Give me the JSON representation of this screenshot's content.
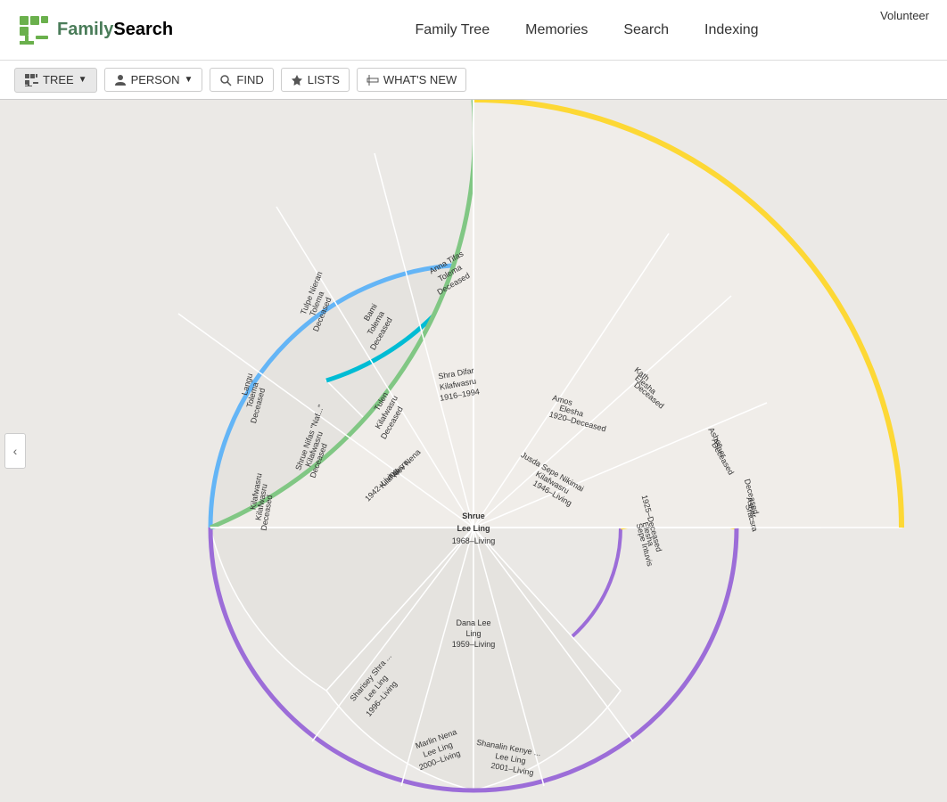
{
  "app": {
    "title": "FamilySearch",
    "volunteer_label": "Volunteer"
  },
  "nav": {
    "links": [
      {
        "label": "Family Tree",
        "id": "family-tree"
      },
      {
        "label": "Memories",
        "id": "memories"
      },
      {
        "label": "Search",
        "id": "search"
      },
      {
        "label": "Indexing",
        "id": "indexing"
      }
    ]
  },
  "subnav": {
    "buttons": [
      {
        "label": "TREE",
        "icon": "tree-icon",
        "active": true,
        "has_dropdown": true
      },
      {
        "label": "PERSON",
        "icon": "person-icon",
        "active": false,
        "has_dropdown": true
      },
      {
        "label": "FIND",
        "icon": "find-icon",
        "active": false,
        "has_dropdown": false
      },
      {
        "label": "LISTS",
        "icon": "lists-icon",
        "active": false,
        "has_dropdown": false
      },
      {
        "label": "WHAT'S NEW",
        "icon": "new-icon",
        "active": false,
        "has_dropdown": false
      }
    ]
  },
  "center_person": {
    "name": "Shrue\nLee Ling",
    "years": "1968–Living"
  },
  "people": [
    {
      "name": "Rev Nena\nKilafwasru",
      "years": "1942–Living",
      "ring": 1,
      "color": "teal"
    },
    {
      "name": "Dana Lee\nLing",
      "years": "1959–Living",
      "ring": 1,
      "color": "purple"
    },
    {
      "name": "Jusda Sepe Nikimai\nKilafwasru",
      "years": "1946–Living",
      "ring": 2,
      "color": "teal"
    },
    {
      "name": "Amos\nElesha",
      "years": "1920–Deceased",
      "ring": 2,
      "color": "red"
    },
    {
      "name": "Sepe Intuvis\nElesha",
      "years": "1925–Deceased",
      "ring": 2,
      "color": "yellow"
    },
    {
      "name": "Tulen\nKilafwasru",
      "years": "Deceased",
      "ring": 2,
      "color": "teal"
    },
    {
      "name": "Shrue Nifas \"Naf...\"\nKilafwasru",
      "years": "Deceased",
      "ring": 2,
      "color": "blue"
    },
    {
      "name": "Sharisey Shra...\nLee Ling",
      "years": "1996–Living",
      "ring": 2,
      "color": "purple"
    },
    {
      "name": "Marlin Nena\nLee Ling",
      "years": "2000–Living",
      "ring": 2,
      "color": "purple"
    },
    {
      "name": "Shanalin Kenye...\nLee Ling",
      "years": "2001–Living",
      "ring": 2,
      "color": "purple"
    },
    {
      "name": "Shra Difar\nKilafwasru",
      "years": "1916–1994",
      "ring": 3,
      "color": "red"
    },
    {
      "name": "Kath\nElesha",
      "years": "Deceased",
      "ring": 3,
      "color": "yellow"
    },
    {
      "name": "Asher\nAsher",
      "years": "Deceased",
      "ring": 3,
      "color": "yellow"
    },
    {
      "name": "Sracsra\nAsher",
      "years": "Deceased",
      "ring": 3,
      "color": "yellow"
    },
    {
      "name": "Kilafwasru\nKilafwasru",
      "years": "Deceased",
      "ring": 3,
      "color": "blue"
    },
    {
      "name": "Bami\nTolema",
      "years": "Deceased",
      "ring": 4,
      "color": "green"
    },
    {
      "name": "Anna Tifas\nTolema",
      "years": "Deceased",
      "ring": 4,
      "color": "green"
    },
    {
      "name": "Langu\nTolema",
      "years": "Deceased",
      "ring": 4,
      "color": "green"
    },
    {
      "name": "Tulpe Nieran\nTolema",
      "years": "Deceased",
      "ring": 4,
      "color": "green"
    }
  ]
}
